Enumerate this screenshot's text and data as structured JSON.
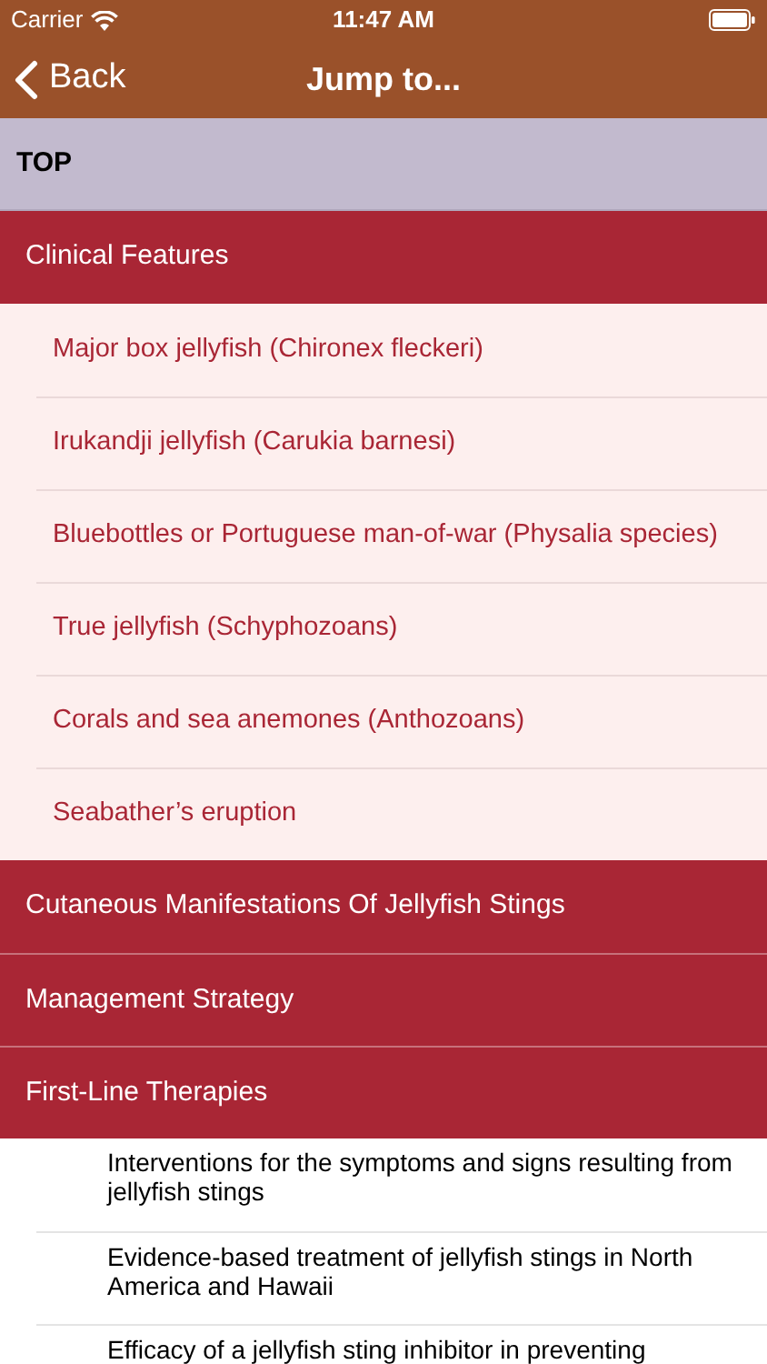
{
  "status_bar": {
    "carrier": "Carrier",
    "time": "11:47 AM"
  },
  "nav_bar": {
    "back": "Back",
    "title": "Jump to..."
  },
  "items": [
    {
      "kind": "top",
      "label": "TOP"
    },
    {
      "kind": "section",
      "label": "Clinical Features",
      "children": [
        {
          "kind": "subsection",
          "label": "Major box jellyfish (Chironex fleckeri)"
        },
        {
          "kind": "subsection",
          "label": "Irukandji jellyfish (Carukia barnesi)"
        },
        {
          "kind": "subsection",
          "label": "Bluebottles or Portuguese man-of-war (Physalia species)"
        },
        {
          "kind": "subsection",
          "label": "True jellyfish (Schyphozoans)"
        },
        {
          "kind": "subsection",
          "label": "Corals and sea anemones (Anthozoans)"
        },
        {
          "kind": "subsection",
          "label": "Seabather’s eruption"
        }
      ]
    },
    {
      "kind": "section",
      "label": "Cutaneous Manifestations Of Jellyfish Stings"
    },
    {
      "kind": "section",
      "label": "Management Strategy"
    },
    {
      "kind": "section",
      "label": "First-Line Therapies",
      "children": [
        {
          "kind": "article",
          "label": "Interventions for the symptoms and signs resulting from jellyfish stings"
        },
        {
          "kind": "article",
          "label": "Evidence-based treatment of jellyfish stings in North America and Hawaii"
        },
        {
          "kind": "article",
          "label": "Efficacy of a jellyfish sting inhibitor in preventing"
        }
      ]
    }
  ]
}
